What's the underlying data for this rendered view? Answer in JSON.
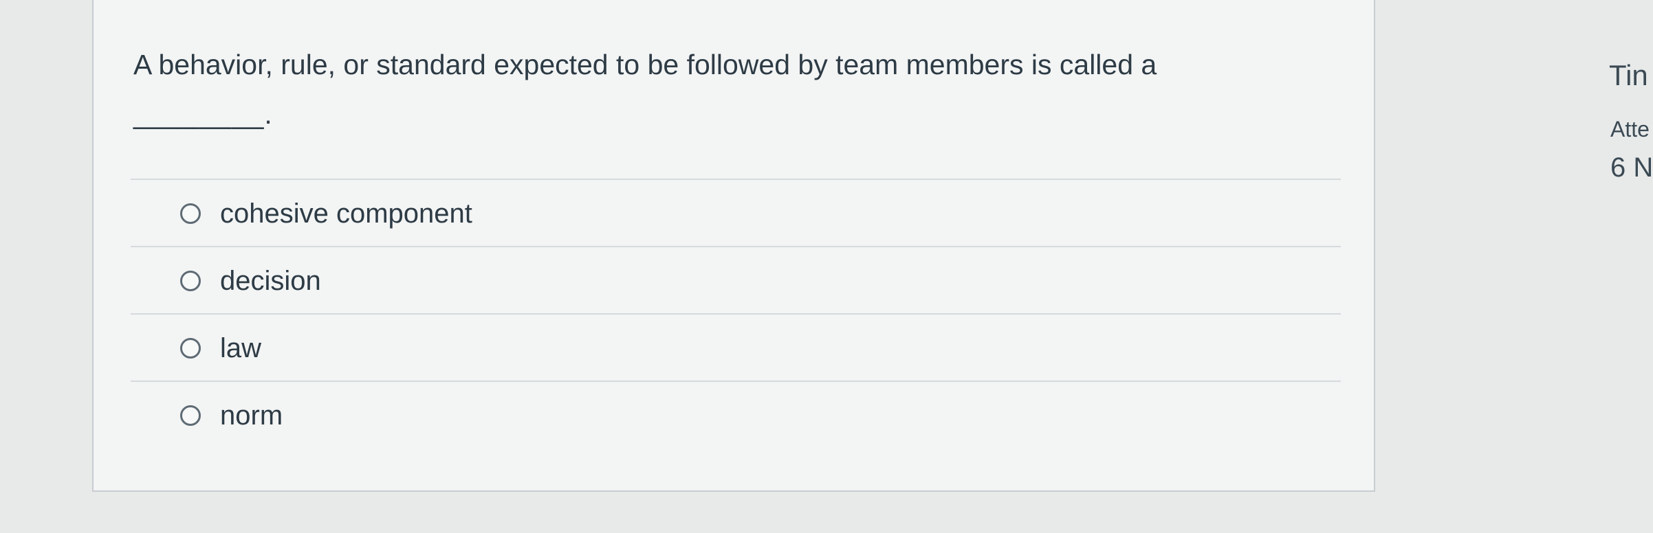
{
  "question": {
    "text": "A behavior, rule, or standard expected to be followed by team members is called a",
    "blank": "________."
  },
  "answers": [
    {
      "label": "cohesive component",
      "selected": false
    },
    {
      "label": "decision",
      "selected": false
    },
    {
      "label": "law",
      "selected": false
    },
    {
      "label": "norm",
      "selected": false
    }
  ],
  "side_panel": {
    "timer_label_partial": "Tin",
    "attempt_label_partial": "Atte",
    "attempt_value_partial": "6 N"
  },
  "colors": {
    "background": "#e8eaea",
    "card": "#f3f4f4",
    "text": "#2d3b45",
    "border": "#c7cdd1"
  }
}
